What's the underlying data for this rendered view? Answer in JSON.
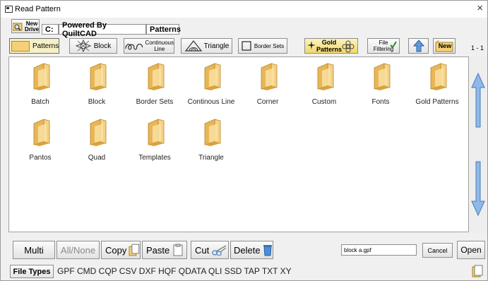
{
  "window": {
    "title": "Read Pattern",
    "close_glyph": "×"
  },
  "nav": {
    "new_drive_label_1": "New",
    "new_drive_label_2": "Drive",
    "path_drive": "C:",
    "path_parts": [
      "Powered By QuiltCAD",
      "Patterns"
    ]
  },
  "toolbar": {
    "patterns": "Patterns",
    "block": "Block",
    "continuous_1": "Continuous",
    "continuous_2": "Line",
    "triangle": "Triangle",
    "border_sets": "Border Sets",
    "gold_1": "Gold",
    "gold_2": "Patterns",
    "file_filtering_1": "File",
    "file_filtering_2": "Filtering",
    "new": "New",
    "page_indicator": "1 - 1"
  },
  "folders": [
    {
      "name": "Batch"
    },
    {
      "name": "Block"
    },
    {
      "name": "Border Sets"
    },
    {
      "name": "Continous Line"
    },
    {
      "name": "Corner"
    },
    {
      "name": "Custom"
    },
    {
      "name": "Fonts"
    },
    {
      "name": "Gold Patterns"
    },
    {
      "name": "Pantos"
    },
    {
      "name": "Quad"
    },
    {
      "name": "Templates"
    },
    {
      "name": "Triangle"
    }
  ],
  "actions": {
    "multi": "Multi",
    "allnone": "All/None",
    "copy": "Copy",
    "paste": "Paste",
    "cut": "Cut",
    "delete": "Delete",
    "filename_value": "block a.gpf",
    "cancel": "Cancel",
    "open": "Open"
  },
  "filetypes": {
    "label": "File Types",
    "list": "GPF  CMD  CQP  CSV  DXF  HQF  QDATA  QLI  SSD  TAP  TXT  XY"
  },
  "colors": {
    "folder": "#f4c96b",
    "accent_blue": "#4a8fd8",
    "gold": "#f3d36b"
  }
}
